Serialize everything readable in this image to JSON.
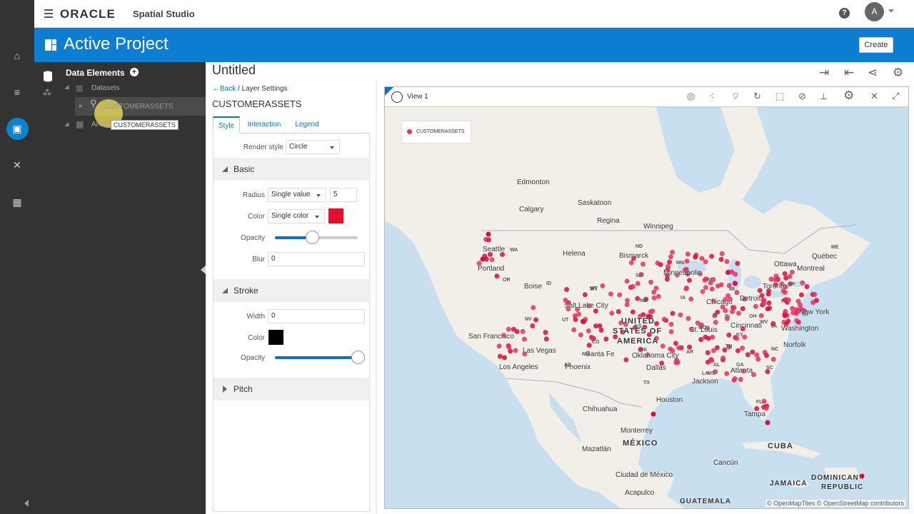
{
  "app": {
    "brand": "ORACLE",
    "product": "Spatial Studio",
    "help": "?",
    "user_initial": "A"
  },
  "project": {
    "title": "Active Project",
    "create_label": "Create"
  },
  "data_elements": {
    "title": "Data Elements",
    "datasets_label": "Datasets",
    "dataset_item": "CUSTOMERASSETS",
    "analyses_label": "Analy",
    "tooltip": "CUSTOMERASSETS"
  },
  "workspace": {
    "title": "Untitled"
  },
  "layer_settings": {
    "back_label": "Back",
    "crumb": " / Layer Settings",
    "layer_name": "CUSTOMERASSETS",
    "tabs": [
      "Style",
      "Interaction",
      "Legend"
    ],
    "render_style_label": "Render style",
    "render_style_value": "Circle",
    "basic": {
      "title": "Basic",
      "radius_label": "Radius",
      "radius_mode": "Single value",
      "radius_value": "5",
      "color_label": "Color",
      "color_mode": "Single color",
      "color_value": "#e0112b",
      "opacity_label": "Opacity",
      "opacity_level": 0.45,
      "blur_label": "Blur",
      "blur_value": "0"
    },
    "stroke": {
      "title": "Stroke",
      "width_label": "Width",
      "width_value": "0",
      "color_label": "Color",
      "color_value": "#000000",
      "opacity_label": "Opacity",
      "opacity_level": 1.0
    },
    "pitch": {
      "title": "Pitch"
    }
  },
  "map": {
    "view_title": "View 1",
    "legend_label": "CUSTOMERASSETS",
    "attribution": "© OpenMapTiles  © OpenStreetMap contributors",
    "labels": {
      "edmonton": "Edmonton",
      "saskatoon": "Saskatoon",
      "calgary": "Calgary",
      "regina": "Regina",
      "winnipeg": "Winnipeg",
      "quebec": "Québec",
      "ottawa": "Ottawa",
      "montreal": "Montreal",
      "toronto": "Toronto",
      "newyork": "New York",
      "washington": "Washington",
      "norfolk": "Norfolk",
      "seattle": "Seattle",
      "portland": "Portland",
      "helena": "Helena",
      "bismarck": "Bismarck",
      "minneapolis": "Minneapolis",
      "boise": "Boise",
      "saltlake": "Salt Lake City",
      "chicago": "Chicago",
      "detroit": "Detroit",
      "cincinnati": "Cincinnati",
      "stlouis": "St. Louis",
      "sanfrancisco": "San Francisco",
      "lasvegas": "Las Vegas",
      "losangeles": "Los Angeles",
      "phoenix": "Phoenix",
      "santafe": "Santa Fe",
      "oklahoma": "Oklahoma City",
      "dallas": "Dallas",
      "atlanta": "Atlanta",
      "jackson": "Jackson",
      "houston": "Houston",
      "tampa": "Tampa",
      "chihuahua": "Chihuahua",
      "monterrey": "Monterrey",
      "mexico": "MÉXICO",
      "mazatlan": "Mazatlán",
      "cdmx": "Ciudad de México",
      "acapulco": "Acapulco",
      "cancun": "Cancún",
      "cuba": "CUBA",
      "jamaica": "JAMAICA",
      "dominican": "DOMINICAN",
      "republic": "REPUBLIC",
      "guatemala": "GUATEMALA",
      "us1": "UNITED",
      "us2": "STATES OF",
      "us3": "AMERICA",
      "states": [
        "WA",
        "OR",
        "ID",
        "MT",
        "WY",
        "NV",
        "UT",
        "CO",
        "ND",
        "SD",
        "NE",
        "KS",
        "OK",
        "TX",
        "NM",
        "AZ",
        "MN",
        "IA",
        "MO",
        "AR",
        "LA",
        "WI",
        "IL",
        "IN",
        "OH",
        "MI",
        "KY",
        "TN",
        "MS",
        "AL",
        "GA",
        "FL",
        "SC",
        "NC",
        "VA",
        "WV",
        "PA",
        "NY",
        "ME",
        "NJ"
      ]
    },
    "point_color": "#e4335f",
    "point_color_dark": "#d40f3a"
  }
}
